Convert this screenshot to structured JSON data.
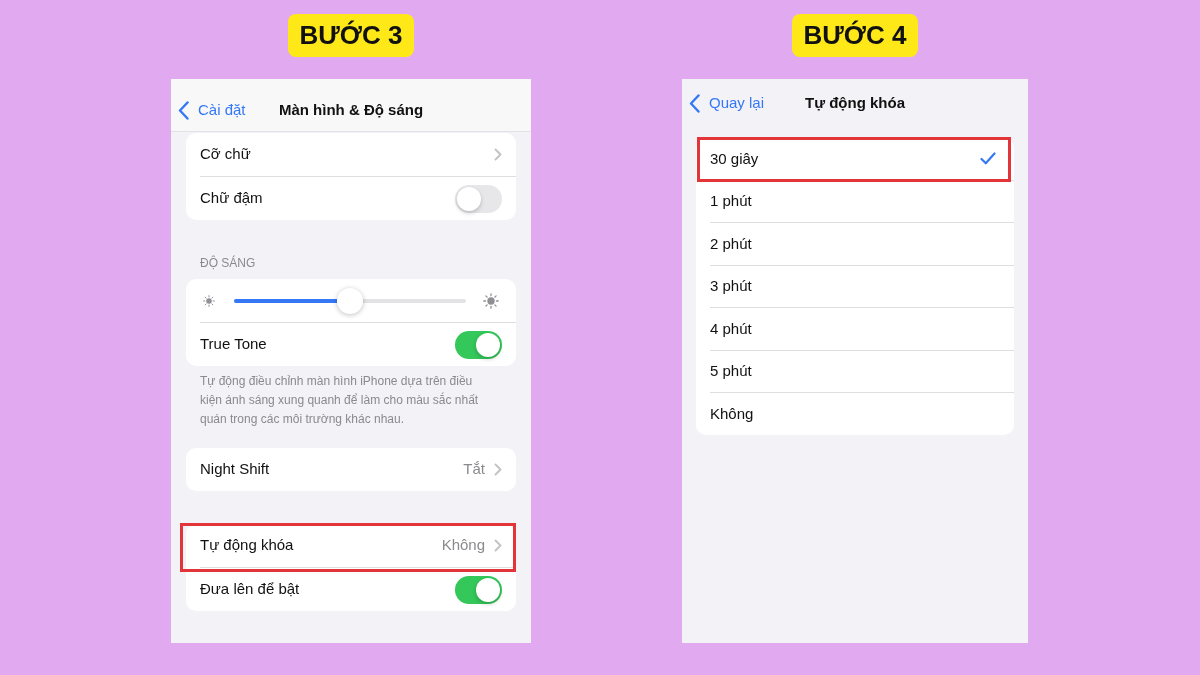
{
  "steps": [
    {
      "kind": "display_settings",
      "badge": "BƯỚC 3",
      "nav": {
        "back": "Cài đặt",
        "title": "Màn hình & Độ sáng"
      },
      "groups": [
        {
          "rows": [
            {
              "kind": "link",
              "label": "Cỡ chữ",
              "highlighted": false
            },
            {
              "kind": "toggle",
              "label": "Chữ đậm",
              "on": false,
              "highlighted": false
            }
          ]
        },
        {
          "header": "ĐỘ SÁNG",
          "rows": [
            {
              "kind": "slider",
              "level": 0.5,
              "highlighted": false
            },
            {
              "kind": "toggle",
              "label": "True Tone",
              "on": true,
              "highlighted": false
            }
          ],
          "footer": "Tự động điều chỉnh màn hình iPhone dựa trên điều kiện ánh sáng xung quanh để làm cho màu sắc nhất quán trong các môi trường khác nhau."
        },
        {
          "rows": [
            {
              "kind": "link",
              "label": "Night Shift",
              "value": "Tắt",
              "highlighted": false
            }
          ]
        },
        {
          "rows": [
            {
              "kind": "link",
              "label": "Tự động khóa",
              "value": "Không",
              "highlighted": true
            },
            {
              "kind": "toggle",
              "label": "Đưa lên để bật",
              "on": true,
              "highlighted": false
            }
          ]
        }
      ]
    },
    {
      "kind": "option_list",
      "badge": "BƯỚC 4",
      "nav": {
        "back": "Quay lại",
        "title": "Tự động khóa"
      },
      "options": [
        {
          "label": "30 giây",
          "selected": true,
          "highlighted": true
        },
        {
          "label": "1 phút",
          "selected": false,
          "highlighted": false
        },
        {
          "label": "2 phút",
          "selected": false,
          "highlighted": false
        },
        {
          "label": "3 phút",
          "selected": false,
          "highlighted": false
        },
        {
          "label": "4 phút",
          "selected": false,
          "highlighted": false
        },
        {
          "label": "5 phút",
          "selected": false,
          "highlighted": false
        },
        {
          "label": "Không",
          "selected": false,
          "highlighted": false
        }
      ]
    }
  ]
}
